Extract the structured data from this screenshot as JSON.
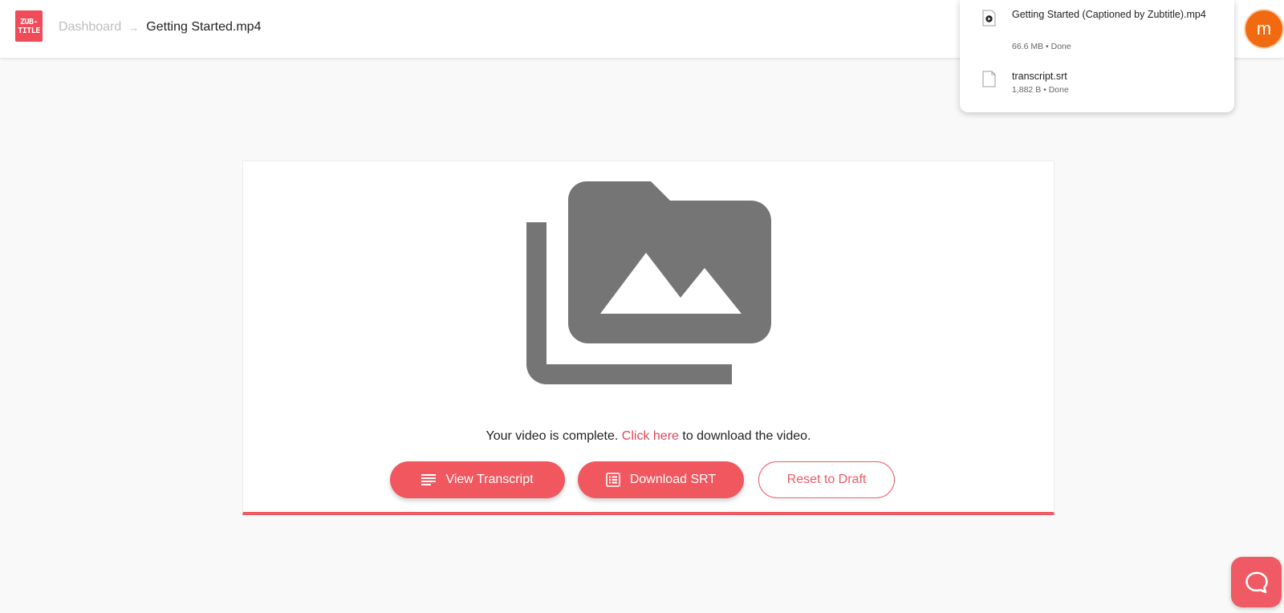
{
  "header": {
    "logo": {
      "line1": "ZUB-",
      "line2": "TITLE"
    },
    "breadcrumb": {
      "dashboard": "Dashboard",
      "separator": "→",
      "current": "Getting Started.mp4"
    },
    "avatar_initial": "m"
  },
  "downloads": {
    "items": [
      {
        "name": "Getting Started (Captioned by Zubtitle).mp4",
        "status": "66.6 MB • Done",
        "icon": "video-file-icon"
      },
      {
        "name": "transcript.srt",
        "status": "1,882 B • Done",
        "icon": "file-icon"
      }
    ]
  },
  "card": {
    "message_before": "Your video is complete. ",
    "message_link": "Click here",
    "message_after": " to download the video.",
    "buttons": {
      "view_transcript": "View Transcript",
      "download_srt": "Download SRT",
      "reset_draft": "Reset to Draft"
    }
  },
  "colors": {
    "accent": "#ef5a64",
    "avatar": "#f26a10",
    "icon_gray": "#757575"
  }
}
